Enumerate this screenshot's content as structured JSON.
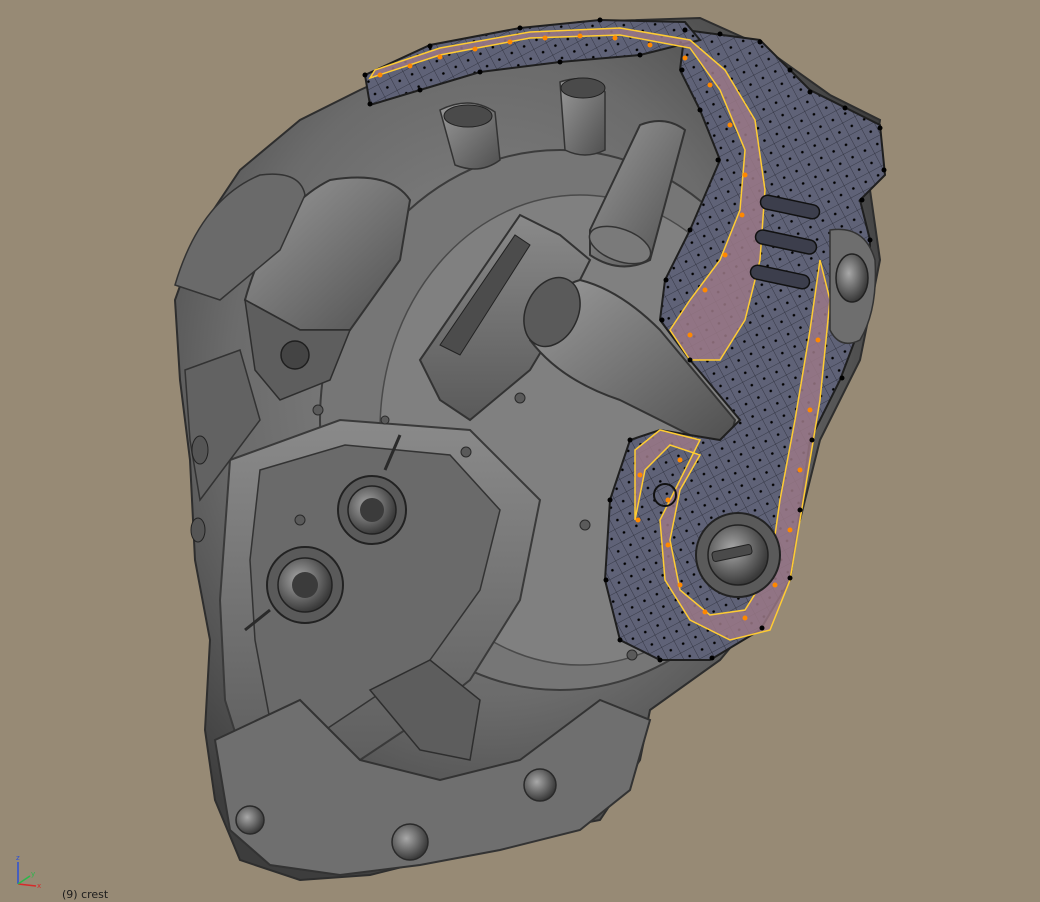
{
  "viewport": {
    "background_color": "#978a75",
    "status_text": "(9) crest"
  },
  "axis_gizmo": {
    "z_label": "z",
    "x_label": "x",
    "y_label": "y",
    "z_color": "#2a4fd6",
    "x_color": "#d62a2a",
    "y_color": "#2ab84a"
  },
  "model": {
    "mesh_color": "#6e6e6e",
    "edit_region_color": "#5f6277",
    "selection_color": "#9a7886",
    "selected_edge_color": "#ffcc33",
    "selected_vertex_color": "#ff8800",
    "vertex_color": "#000000"
  }
}
